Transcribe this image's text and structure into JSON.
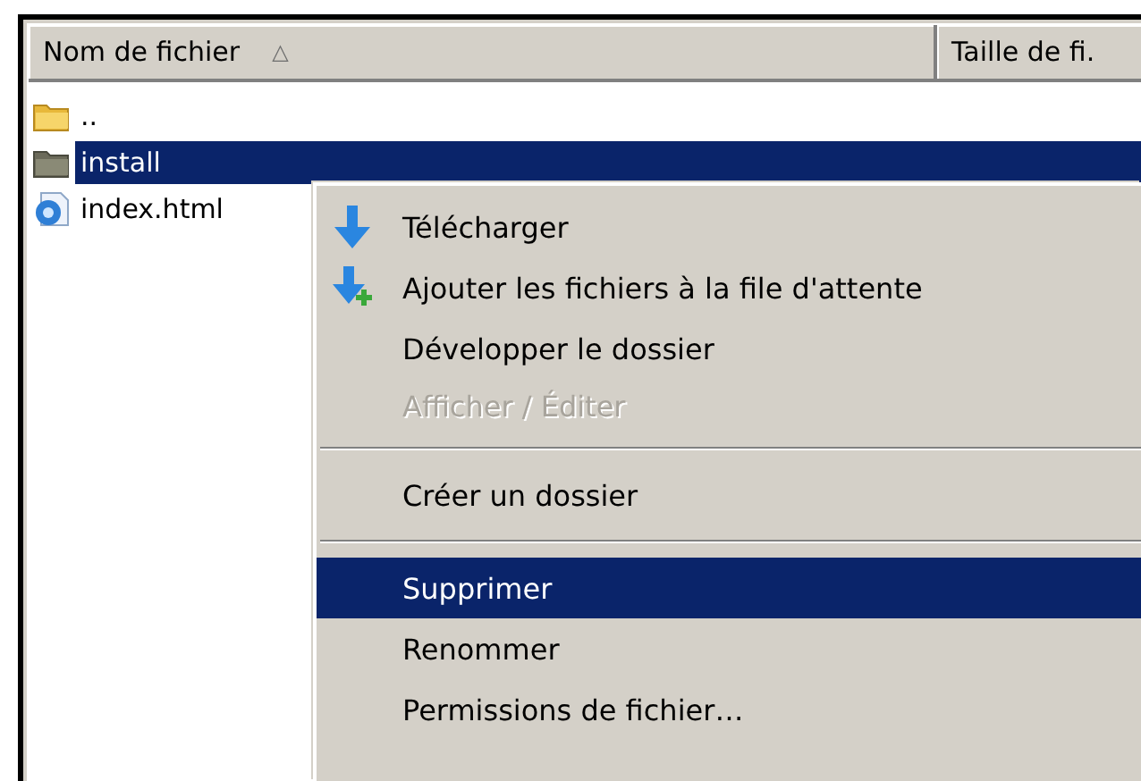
{
  "columns": [
    {
      "label": "Nom de fichier",
      "sort_icon": "△"
    },
    {
      "label": "Taille de fi."
    }
  ],
  "files": [
    {
      "name": "..",
      "kind": "parent",
      "selected": false
    },
    {
      "name": "install",
      "kind": "folder",
      "selected": true
    },
    {
      "name": "index.html",
      "kind": "html",
      "selected": false
    }
  ],
  "context_menu": [
    {
      "kind": "download",
      "label": "Télécharger",
      "disabled": false,
      "selected": false
    },
    {
      "kind": "queue",
      "label": "Ajouter les fichiers à la file d'attente",
      "disabled": false,
      "selected": false
    },
    {
      "kind": "plain",
      "label": "Développer le dossier",
      "disabled": false,
      "selected": false
    },
    {
      "kind": "plain",
      "label": "Afficher / Éditer",
      "disabled": true,
      "selected": false
    },
    {
      "kind": "separator"
    },
    {
      "kind": "plain",
      "label": "Créer un dossier",
      "disabled": false,
      "selected": false
    },
    {
      "kind": "separator"
    },
    {
      "kind": "plain",
      "label": "Supprimer",
      "disabled": false,
      "selected": true
    },
    {
      "kind": "plain",
      "label": "Renommer",
      "disabled": false,
      "selected": false
    },
    {
      "kind": "plain",
      "label": "Permissions de fichier…",
      "disabled": false,
      "selected": false
    }
  ]
}
